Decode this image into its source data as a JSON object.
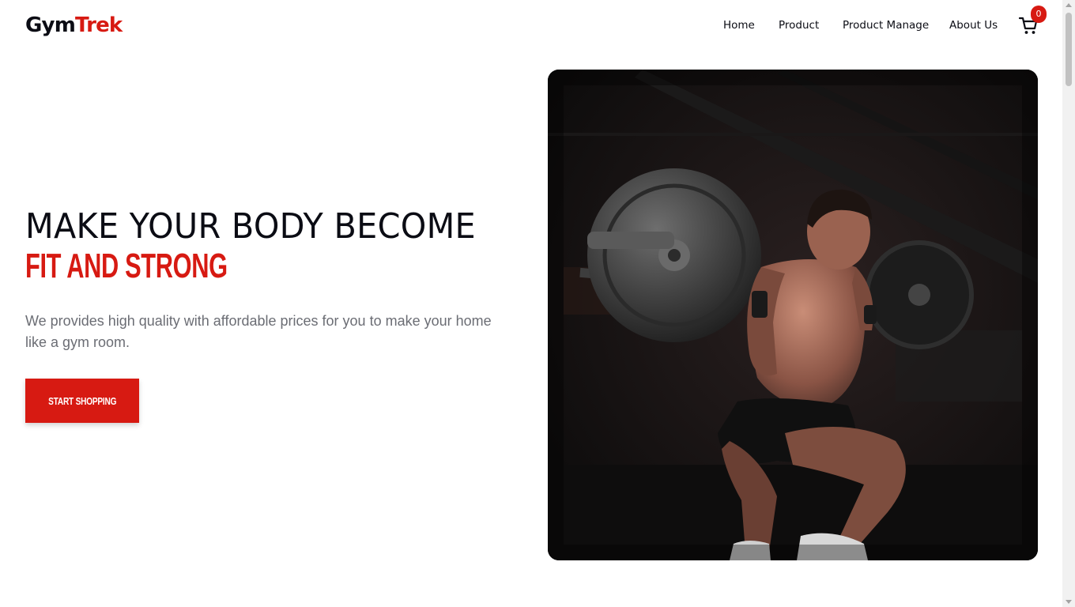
{
  "brand": {
    "part1": "Gym",
    "part2": "Trek",
    "color_primary": "#0b0c14",
    "color_accent": "#d71a12"
  },
  "nav": {
    "items": [
      {
        "label": "Home"
      },
      {
        "label": "Product"
      },
      {
        "label": "Product Manage"
      },
      {
        "label": "About Us"
      }
    ]
  },
  "cart": {
    "icon": "cart-icon",
    "count": "0"
  },
  "hero": {
    "title_line1": "MAKE YOUR BODY BECOME",
    "title_line2": "FIT AND STRONG",
    "description": "We provides high quality with affordable prices for you to make your home like a gym room.",
    "cta_label": "START SHOPPING"
  },
  "image": {
    "icon": "gym-photo"
  }
}
